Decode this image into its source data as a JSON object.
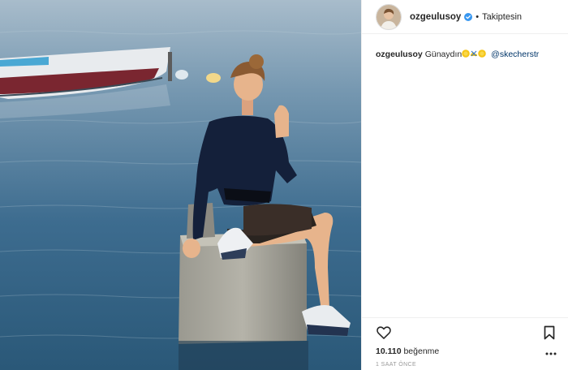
{
  "post": {
    "username": "ozgeulusoy",
    "verified_icon": "verified-badge-icon",
    "separator": "•",
    "follow_state": "Takiptesin",
    "caption": {
      "username": "ozgeulusoy",
      "text": "Günaydın",
      "emojis": [
        "sun-emoji",
        "running-shoe-emoji",
        "sun-emoji"
      ],
      "mention": "@skecherstr"
    },
    "likes_count": "10.110",
    "likes_label": "beğenme",
    "timestamp": "1 SAAT ÖNCE"
  },
  "icons": {
    "like": "heart-outline-icon",
    "save": "bookmark-outline-icon",
    "more": "more-dots-icon"
  },
  "colors": {
    "verified": "#3897f0",
    "mention": "#003569",
    "border": "#efefef",
    "muted": "#999999"
  }
}
